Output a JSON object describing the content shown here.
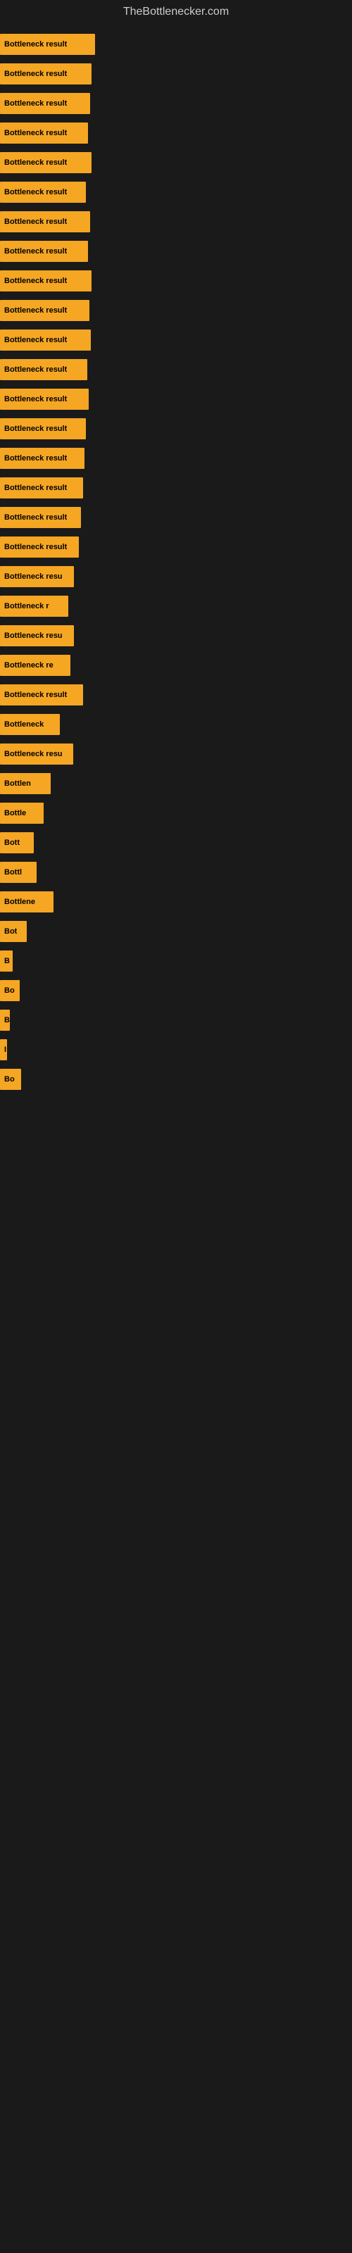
{
  "site": {
    "title": "TheBottlenecker.com"
  },
  "bars": [
    {
      "label": "Bottleneck result",
      "width": 135
    },
    {
      "label": "Bottleneck result",
      "width": 130
    },
    {
      "label": "Bottleneck result",
      "width": 128
    },
    {
      "label": "Bottleneck result",
      "width": 125
    },
    {
      "label": "Bottleneck result",
      "width": 130
    },
    {
      "label": "Bottleneck result",
      "width": 122
    },
    {
      "label": "Bottleneck result",
      "width": 128
    },
    {
      "label": "Bottleneck result",
      "width": 125
    },
    {
      "label": "Bottleneck result",
      "width": 130
    },
    {
      "label": "Bottleneck result",
      "width": 127
    },
    {
      "label": "Bottleneck result",
      "width": 129
    },
    {
      "label": "Bottleneck result",
      "width": 124
    },
    {
      "label": "Bottleneck result",
      "width": 126
    },
    {
      "label": "Bottleneck result",
      "width": 122
    },
    {
      "label": "Bottleneck result",
      "width": 120
    },
    {
      "label": "Bottleneck result",
      "width": 118
    },
    {
      "label": "Bottleneck result",
      "width": 115
    },
    {
      "label": "Bottleneck result",
      "width": 112
    },
    {
      "label": "Bottleneck resu",
      "width": 105
    },
    {
      "label": "Bottleneck r",
      "width": 97
    },
    {
      "label": "Bottleneck resu",
      "width": 105
    },
    {
      "label": "Bottleneck re",
      "width": 100
    },
    {
      "label": "Bottleneck result",
      "width": 118
    },
    {
      "label": "Bottleneck",
      "width": 85
    },
    {
      "label": "Bottleneck resu",
      "width": 104
    },
    {
      "label": "Bottlen",
      "width": 72
    },
    {
      "label": "Bottle",
      "width": 62
    },
    {
      "label": "Bott",
      "width": 48
    },
    {
      "label": "Bottl",
      "width": 52
    },
    {
      "label": "Bottlene",
      "width": 76
    },
    {
      "label": "Bot",
      "width": 38
    },
    {
      "label": "B",
      "width": 18
    },
    {
      "label": "Bo",
      "width": 28
    },
    {
      "label": "B",
      "width": 14
    },
    {
      "label": "I",
      "width": 10
    },
    {
      "label": "Bo",
      "width": 30
    }
  ],
  "colors": {
    "bar_fill": "#f5a623",
    "background": "#1a1a1a",
    "title": "#cccccc"
  }
}
